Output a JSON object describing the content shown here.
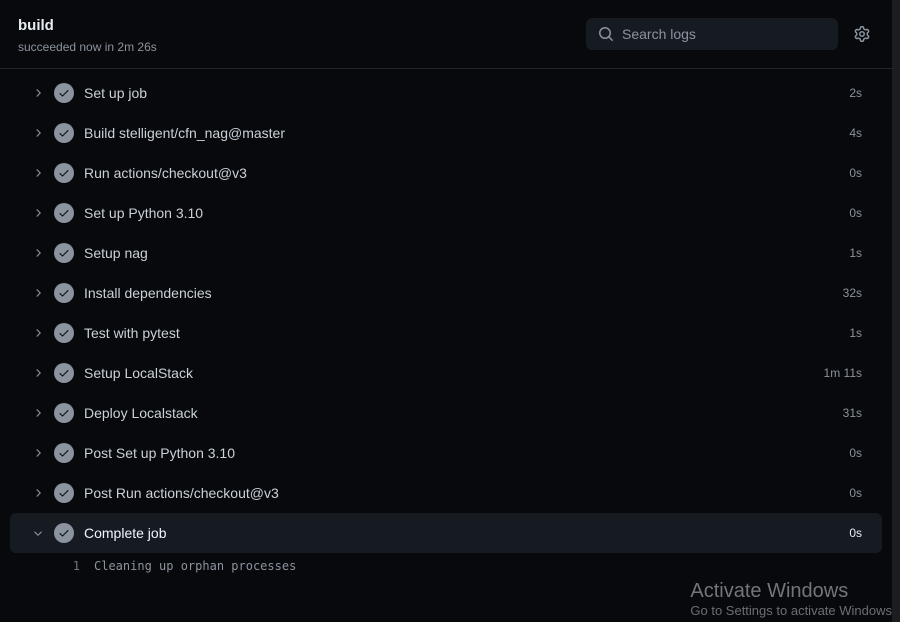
{
  "header": {
    "title": "build",
    "subtitle": "succeeded now in 2m 26s"
  },
  "search": {
    "placeholder": "Search logs"
  },
  "steps": [
    {
      "name": "Set up job",
      "duration": "2s",
      "expanded": false
    },
    {
      "name": "Build stelligent/cfn_nag@master",
      "duration": "4s",
      "expanded": false
    },
    {
      "name": "Run actions/checkout@v3",
      "duration": "0s",
      "expanded": false
    },
    {
      "name": "Set up Python 3.10",
      "duration": "0s",
      "expanded": false
    },
    {
      "name": "Setup nag",
      "duration": "1s",
      "expanded": false
    },
    {
      "name": "Install dependencies",
      "duration": "32s",
      "expanded": false
    },
    {
      "name": "Test with pytest",
      "duration": "1s",
      "expanded": false
    },
    {
      "name": "Setup LocalStack",
      "duration": "1m 11s",
      "expanded": false
    },
    {
      "name": "Deploy Localstack",
      "duration": "31s",
      "expanded": false
    },
    {
      "name": "Post Set up Python 3.10",
      "duration": "0s",
      "expanded": false
    },
    {
      "name": "Post Run actions/checkout@v3",
      "duration": "0s",
      "expanded": false
    },
    {
      "name": "Complete job",
      "duration": "0s",
      "expanded": true
    }
  ],
  "log": {
    "line_number": "1",
    "text": "Cleaning up orphan processes"
  },
  "watermark": {
    "title": "Activate Windows",
    "subtitle": "Go to Settings to activate Windows"
  }
}
